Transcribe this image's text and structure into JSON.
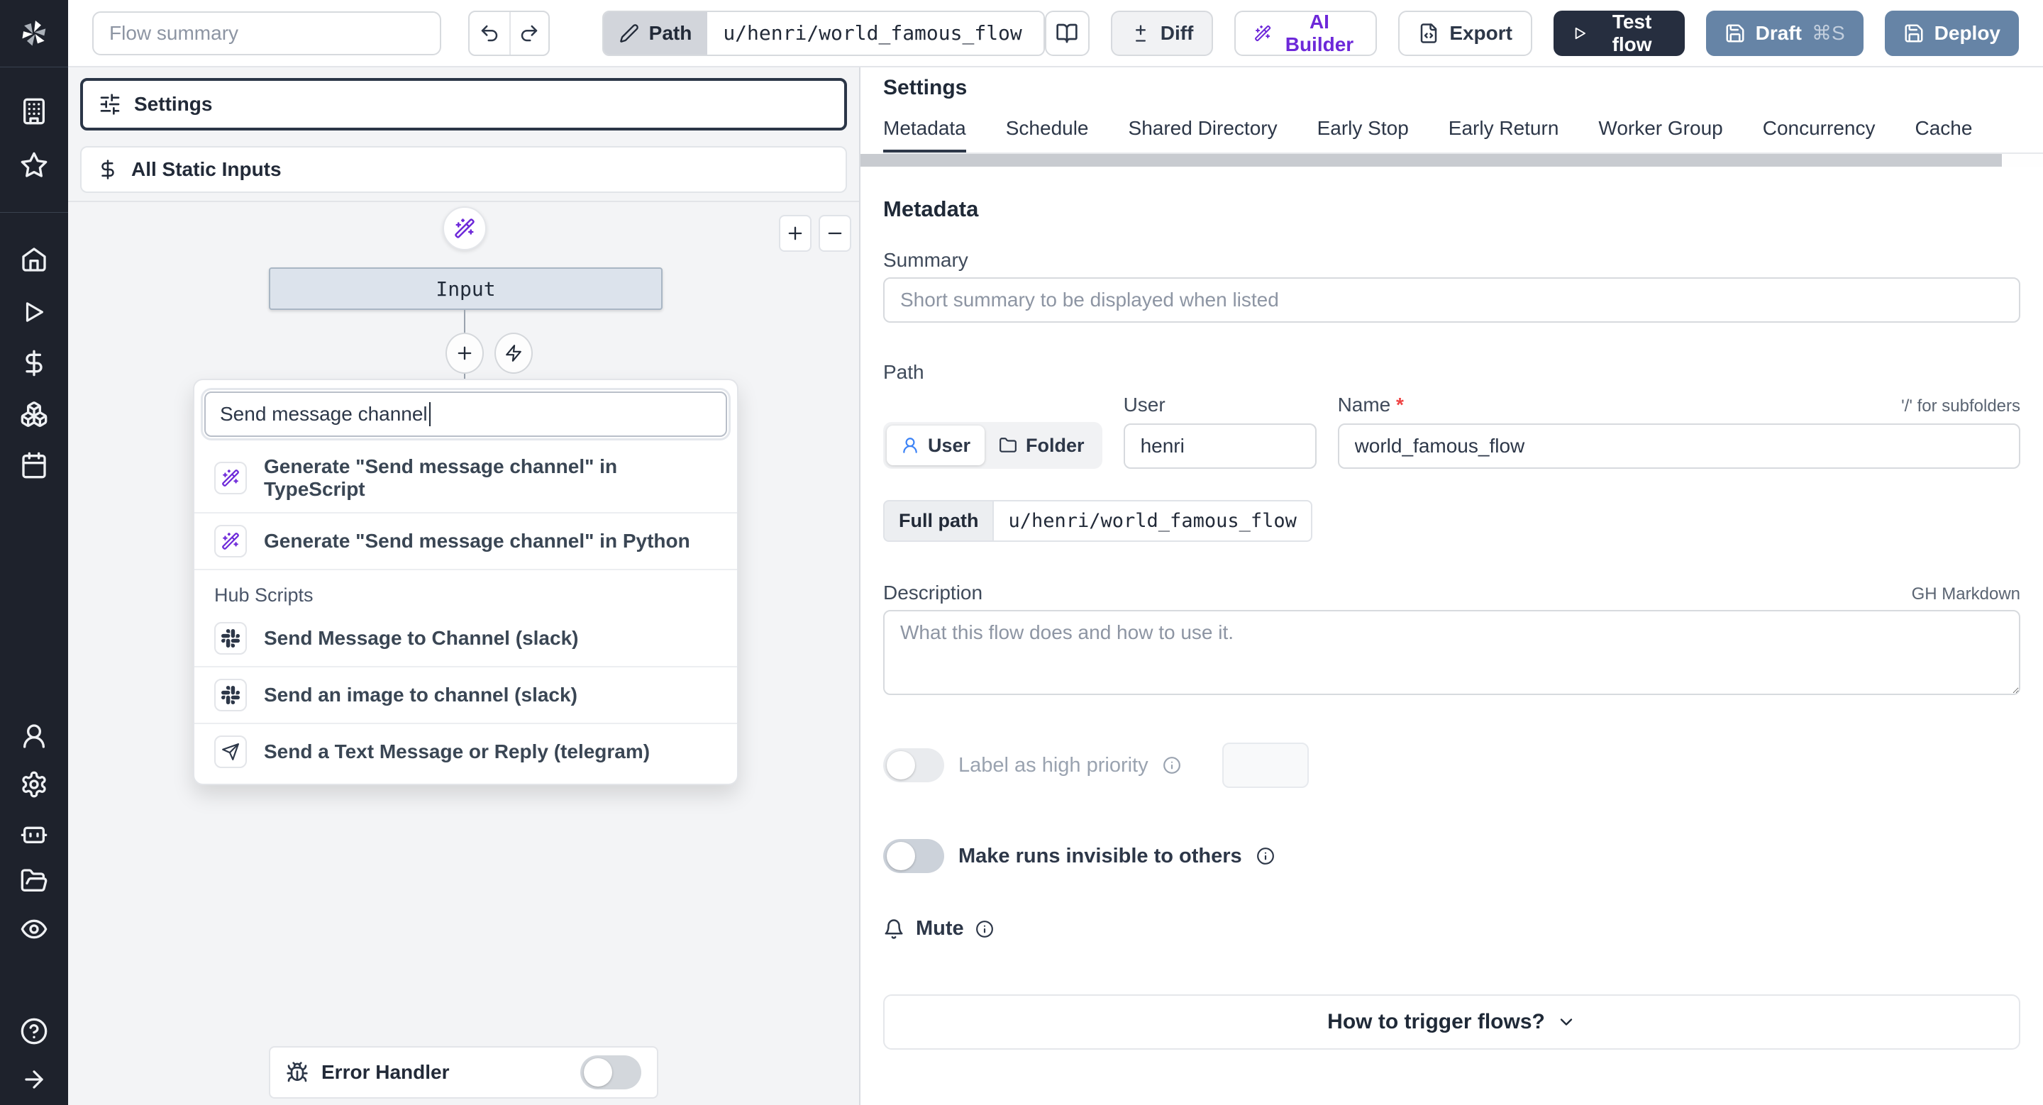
{
  "topbar": {
    "flow_summary_placeholder": "Flow summary",
    "path_label": "Path",
    "path_value": "u/henri/world_famous_flow",
    "diff_label": "Diff",
    "ai_builder_label": "AI Builder",
    "export_label": "Export",
    "test_flow_label": "Test flow",
    "draft_label": "Draft",
    "draft_shortcut": "⌘S",
    "deploy_label": "Deploy"
  },
  "left_panel": {
    "settings_label": "Settings",
    "static_inputs_label": "All Static Inputs",
    "input_node_label": "Input",
    "search_value": "Send message channel",
    "results": [
      {
        "icon": "wand-icon",
        "label": "Generate \"Send message channel\" in TypeScript"
      },
      {
        "icon": "wand-icon",
        "label": "Generate \"Send message channel\" in Python"
      }
    ],
    "hub_section_label": "Hub Scripts",
    "hub_results": [
      {
        "icon": "slack-icon",
        "label": "Send Message to Channel (slack)"
      },
      {
        "icon": "slack-icon",
        "label": "Send an image to channel (slack)"
      },
      {
        "icon": "telegram-icon",
        "label": "Send a Text Message or Reply (telegram)"
      }
    ],
    "error_handler_label": "Error Handler"
  },
  "right_panel": {
    "title": "Settings",
    "tabs": [
      "Metadata",
      "Schedule",
      "Shared Directory",
      "Early Stop",
      "Early Return",
      "Worker Group",
      "Concurrency",
      "Cache"
    ],
    "active_tab": "Metadata",
    "metadata": {
      "heading": "Metadata",
      "summary_label": "Summary",
      "summary_placeholder": "Short summary to be displayed when listed",
      "path_label": "Path",
      "owner_user_label": "User",
      "owner_folder_label": "Folder",
      "user_label": "User",
      "user_value": "henri",
      "name_label": "Name",
      "name_required_mark": "*",
      "subfolder_hint": "'/' for subfolders",
      "name_value": "world_famous_flow",
      "full_path_label": "Full path",
      "full_path_value": "u/henri/world_famous_flow",
      "description_label": "Description",
      "markdown_hint": "GH Markdown",
      "description_placeholder": "What this flow does and how to use it.",
      "high_priority_label": "Label as high priority",
      "invisible_runs_label": "Make runs invisible to others",
      "mute_label": "Mute",
      "trigger_help_label": "How to trigger flows?"
    }
  },
  "colors": {
    "accent_blue": "#3b82f6",
    "brand_purple": "#6d28d9",
    "deploy_slate": "#6684a6",
    "test_dark": "#262e3f",
    "sidebar_dark": "#1e222c",
    "required_red": "#ef4444"
  }
}
